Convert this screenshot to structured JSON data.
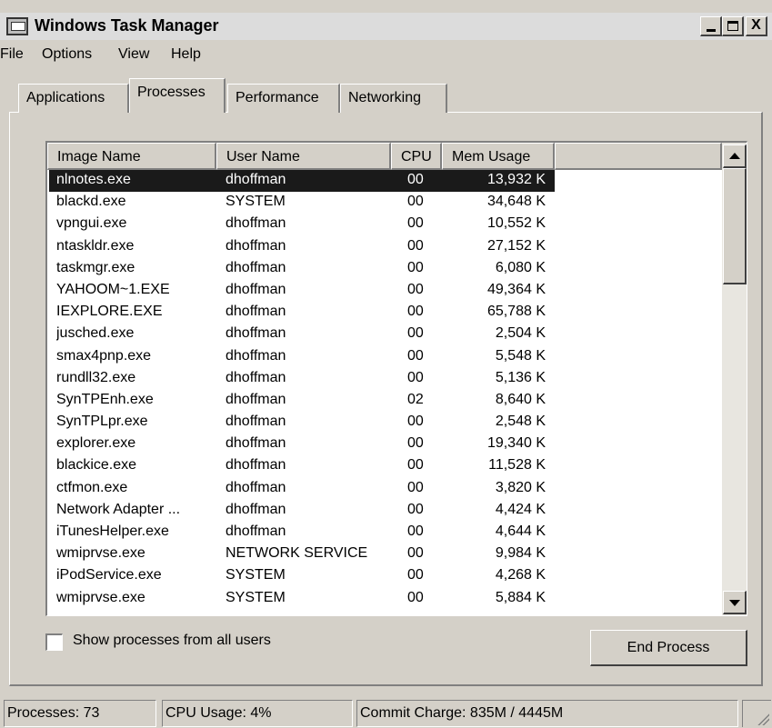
{
  "window": {
    "title": "Windows Task Manager",
    "minimize_glyph": "",
    "maximize_glyph": "",
    "close_glyph": "X"
  },
  "menu": [
    "File",
    "Options",
    "View",
    "Help"
  ],
  "tabs": [
    {
      "label": "Applications",
      "active": false
    },
    {
      "label": "Processes",
      "active": true
    },
    {
      "label": "Performance",
      "active": false
    },
    {
      "label": "Networking",
      "active": false
    }
  ],
  "process_list": {
    "columns": [
      "Image Name",
      "User Name",
      "CPU",
      "Mem Usage"
    ],
    "selected_index": 0,
    "rows": [
      {
        "image": "nlnotes.exe",
        "user": "dhoffman",
        "cpu": "00",
        "mem": "13,932 K"
      },
      {
        "image": "blackd.exe",
        "user": "SYSTEM",
        "cpu": "00",
        "mem": "34,648 K"
      },
      {
        "image": "vpngui.exe",
        "user": "dhoffman",
        "cpu": "00",
        "mem": "10,552 K"
      },
      {
        "image": "ntaskldr.exe",
        "user": "dhoffman",
        "cpu": "00",
        "mem": "27,152 K"
      },
      {
        "image": "taskmgr.exe",
        "user": "dhoffman",
        "cpu": "00",
        "mem": "6,080 K"
      },
      {
        "image": "YAHOOM~1.EXE",
        "user": "dhoffman",
        "cpu": "00",
        "mem": "49,364 K"
      },
      {
        "image": "IEXPLORE.EXE",
        "user": "dhoffman",
        "cpu": "00",
        "mem": "65,788 K"
      },
      {
        "image": "jusched.exe",
        "user": "dhoffman",
        "cpu": "00",
        "mem": "2,504 K"
      },
      {
        "image": "smax4pnp.exe",
        "user": "dhoffman",
        "cpu": "00",
        "mem": "5,548 K"
      },
      {
        "image": "rundll32.exe",
        "user": "dhoffman",
        "cpu": "00",
        "mem": "5,136 K"
      },
      {
        "image": "SynTPEnh.exe",
        "user": "dhoffman",
        "cpu": "02",
        "mem": "8,640 K"
      },
      {
        "image": "SynTPLpr.exe",
        "user": "dhoffman",
        "cpu": "00",
        "mem": "2,548 K"
      },
      {
        "image": "explorer.exe",
        "user": "dhoffman",
        "cpu": "00",
        "mem": "19,340 K"
      },
      {
        "image": "blackice.exe",
        "user": "dhoffman",
        "cpu": "00",
        "mem": "11,528 K"
      },
      {
        "image": "ctfmon.exe",
        "user": "dhoffman",
        "cpu": "00",
        "mem": "3,820 K"
      },
      {
        "image": "Network Adapter ...",
        "user": "dhoffman",
        "cpu": "00",
        "mem": "4,424 K"
      },
      {
        "image": "iTunesHelper.exe",
        "user": "dhoffman",
        "cpu": "00",
        "mem": "4,644 K"
      },
      {
        "image": "wmiprvse.exe",
        "user": "NETWORK SERVICE",
        "cpu": "00",
        "mem": "9,984 K"
      },
      {
        "image": "iPodService.exe",
        "user": "SYSTEM",
        "cpu": "00",
        "mem": "4,268 K"
      },
      {
        "image": "wmiprvse.exe",
        "user": "SYSTEM",
        "cpu": "00",
        "mem": "5,884 K"
      }
    ]
  },
  "show_all_processes": {
    "label": "Show processes from all users",
    "checked": false
  },
  "end_process_label": "End Process",
  "status": {
    "processes": "Processes: 73",
    "cpu_usage": "CPU Usage: 4%",
    "commit_charge": "Commit Charge: 835M / 4445M"
  },
  "icons": {
    "app": "task-manager-icon",
    "scroll_up": "arrow-up-icon",
    "scroll_down": "arrow-down-icon",
    "size_grip": "size-grip-icon"
  }
}
